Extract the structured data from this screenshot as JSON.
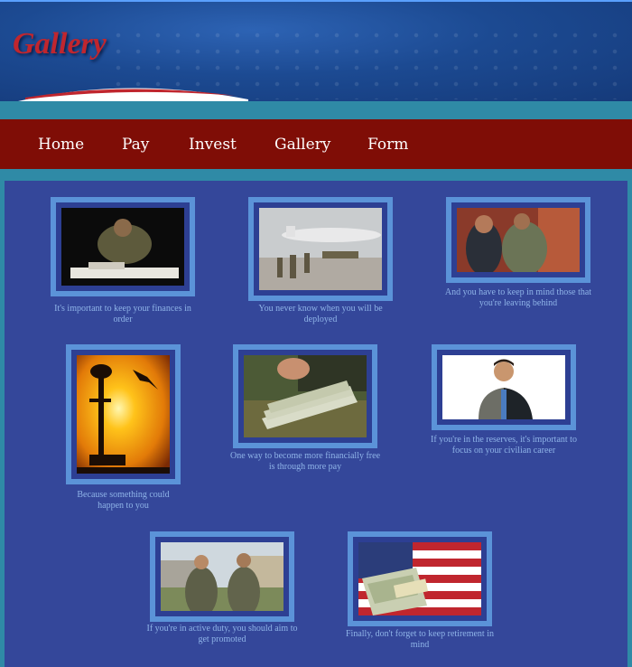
{
  "header": {
    "title": "Gallery"
  },
  "nav": [
    {
      "label": "Home"
    },
    {
      "label": "Pay"
    },
    {
      "label": "Invest"
    },
    {
      "label": "Gallery"
    },
    {
      "label": "Form"
    }
  ],
  "gallery": [
    {
      "caption": "It's important to keep your finances in order",
      "icon": "soldier-worried-photo"
    },
    {
      "caption": "You never know when you will be deployed",
      "icon": "troops-plane-photo"
    },
    {
      "caption": "And you have to keep in mind those that you're leaving behind",
      "icon": "family-hug-photo"
    },
    {
      "caption": "Because something could happen to you",
      "icon": "memorial-sunset-photo"
    },
    {
      "caption": "One way to become more financially free is through more pay",
      "icon": "cash-hand-photo"
    },
    {
      "caption": "If you're in the reserves, it's important to focus on your civilian career",
      "icon": "half-suit-half-uniform-photo"
    },
    {
      "caption": "If you're in active duty, you should aim to get promoted",
      "icon": "promotion-photo"
    },
    {
      "caption": "Finally, don't forget to keep retirement in mind",
      "icon": "flag-money-photo"
    }
  ]
}
